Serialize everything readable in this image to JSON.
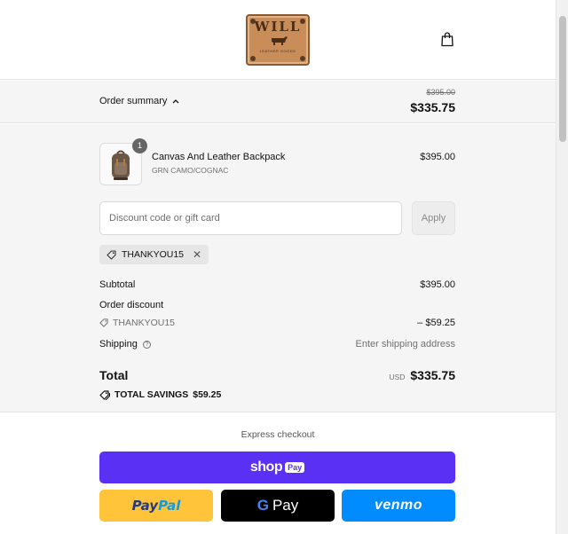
{
  "header": {
    "logo": {
      "word": "WILL",
      "sub": "LEATHER GOODS"
    },
    "bag_icon": "shopping-bag-icon"
  },
  "summary": {
    "toggle_label": "Order summary",
    "original_total": "$395.00",
    "current_total": "$335.75"
  },
  "item": {
    "quantity": "1",
    "name": "Canvas And Leather Backpack",
    "variant": "GRN CAMO/COGNAC",
    "price": "$395.00"
  },
  "discount": {
    "placeholder": "Discount code or gift card",
    "apply_label": "Apply",
    "applied_code": "THANKYOU15"
  },
  "totals": {
    "subtotal_label": "Subtotal",
    "subtotal_value": "$395.00",
    "order_discount_label": "Order discount",
    "discount_code": "THANKYOU15",
    "discount_value": "– $59.25",
    "shipping_label": "Shipping",
    "shipping_value": "Enter shipping address",
    "total_label": "Total",
    "currency": "USD",
    "total_value": "$335.75",
    "savings_label": "TOTAL SAVINGS",
    "savings_value": "$59.25"
  },
  "express": {
    "label": "Express checkout",
    "shop_text": "shop",
    "shop_pay": "Pay",
    "paypal_a": "Pay",
    "paypal_b": "Pal",
    "gpay_g": "G",
    "gpay_text": "Pay",
    "venmo": "venmo"
  },
  "colors": {
    "shop_pay": "#5a31f4",
    "paypal": "#ffc439",
    "gpay": "#000000",
    "venmo": "#008cff"
  }
}
